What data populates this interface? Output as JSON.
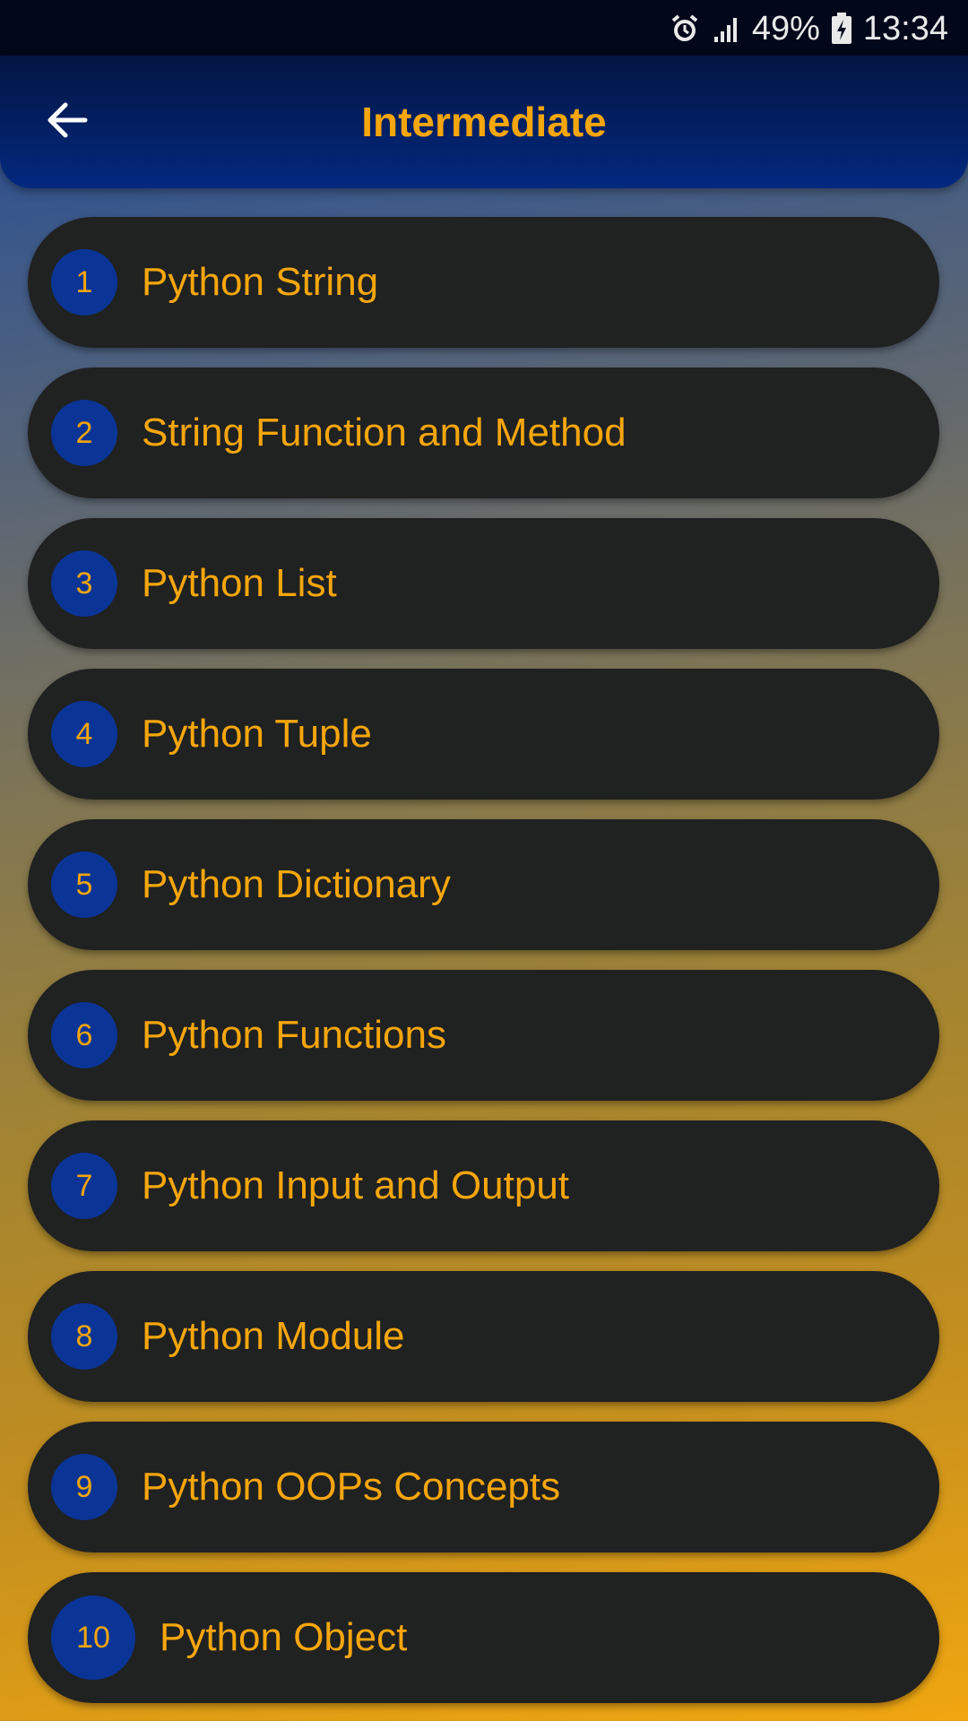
{
  "status_bar": {
    "battery": "49%",
    "time": "13:34",
    "icons": [
      "alarm-icon",
      "signal-icon",
      "battery-charging-icon"
    ]
  },
  "header": {
    "title": "Intermediate",
    "back_icon": "arrow-left-icon"
  },
  "colors": {
    "accent": "#f5a60c",
    "card": "#202121",
    "badge": "#0a3596",
    "header": "#03287f"
  },
  "topics": [
    {
      "number": "1",
      "label": "Python String"
    },
    {
      "number": "2",
      "label": "String Function and Method"
    },
    {
      "number": "3",
      "label": "Python List"
    },
    {
      "number": "4",
      "label": "Python Tuple"
    },
    {
      "number": "5",
      "label": "Python Dictionary"
    },
    {
      "number": "6",
      "label": "Python Functions"
    },
    {
      "number": "7",
      "label": "Python Input and Output"
    },
    {
      "number": "8",
      "label": "Python Module"
    },
    {
      "number": "9",
      "label": "Python OOPs Concepts"
    },
    {
      "number": "10",
      "label": "Python Object"
    }
  ]
}
